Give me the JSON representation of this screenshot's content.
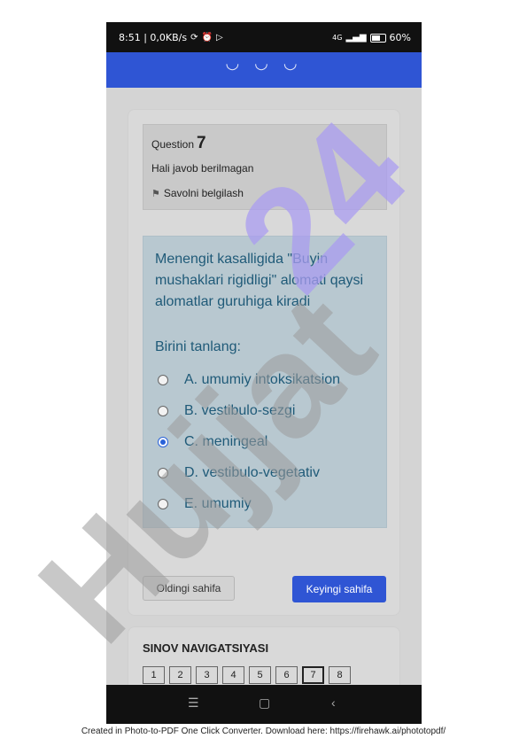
{
  "status_bar": {
    "time_net": "8:51 | 0,0KB/s",
    "right_signal": "4G",
    "battery": "60%"
  },
  "question": {
    "label": "Question",
    "number": "7",
    "state": "Hali javob berilmagan",
    "flag_label": "Savolni belgilash",
    "text": "Menengit kasalligida \"Buyin mushaklari rigidligi\" alomati qaysi alomatlar guruhiga kiradi",
    "choose_label": "Birini tanlang:",
    "options": [
      {
        "label": "A. umumiy intoksikatsion",
        "checked": false
      },
      {
        "label": "B. vestibulo-sezgi",
        "checked": false
      },
      {
        "label": "C. meningeal",
        "checked": true
      },
      {
        "label": "D. vestibulo-vegetativ",
        "checked": false
      },
      {
        "label": "E. umumiy",
        "checked": false
      }
    ]
  },
  "buttons": {
    "prev": "Oldingi sahifa",
    "next": "Keyingi sahifa"
  },
  "navigation": {
    "title": "SINOV NAVIGATSIYASI",
    "pages": [
      "1",
      "2",
      "3",
      "4",
      "5",
      "6",
      "7",
      "8"
    ],
    "current_page": "7"
  },
  "watermark": "Hujjat24",
  "footer": "Created in Photo-to-PDF One Click Converter. Download here: https://firehawk.ai/phototopdf/",
  "colors": {
    "accent": "#2f55d4",
    "question_text": "#1f5a78",
    "watermark_purple": "#a99cf0",
    "watermark_gray": "#9a9a9a"
  }
}
